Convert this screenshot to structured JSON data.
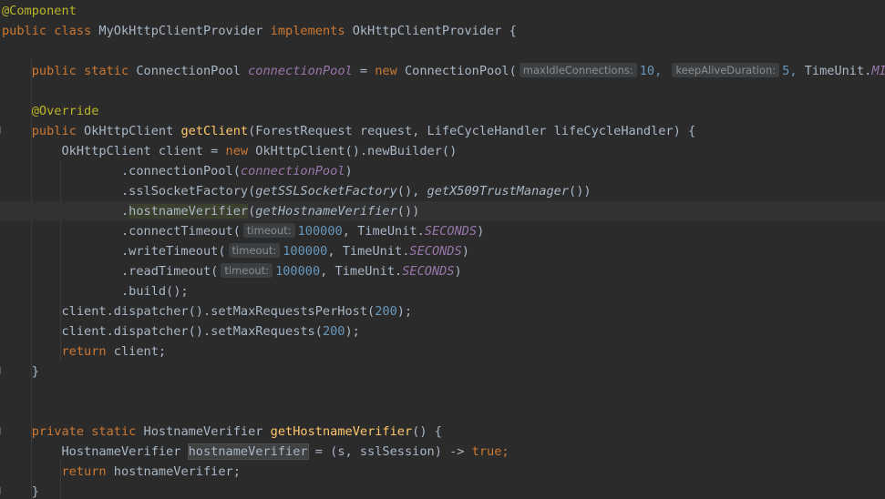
{
  "code": {
    "annotation_component": "@Component",
    "kw_public": "public",
    "kw_class": "class",
    "class_name": "MyOkHttpClientProvider",
    "kw_implements": "implements",
    "iface_name": "OkHttpClientProvider",
    "brace_open": "{",
    "brace_close": "}",
    "kw_static": "static",
    "type_pool": "ConnectionPool",
    "field_pool": "connectionPool",
    "assign": "=",
    "kw_new": "new",
    "ctor_pool": "ConnectionPool(",
    "hint_max_idle": "maxIdleConnections:",
    "num_10": "10,",
    "hint_keep_alive": "keepAliveDuration:",
    "num_5": "5,",
    "time_unit_prefix": "TimeUnit.",
    "time_unit_minutes_partial": "MINU",
    "annotation_override": "@Override",
    "type_client": "OkHttpClient",
    "fn_get_client": "getClient",
    "params_get_client": "(ForestRequest request, LifeCycleHandler lifeCycleHandler)",
    "decl_client": "OkHttpClient client",
    "ctor_client": "OkHttpClient().newBuilder()",
    "call_connection_pool_open": ".connectionPool(",
    "close_paren": ")",
    "call_ssl_open": ".sslSocketFactory(",
    "fn_get_ssl": "getSSLSocketFactory",
    "call_empty": "()",
    "comma_space": ", ",
    "fn_get_trust": "getX509TrustManager",
    "call_close": "())",
    "call_hostname_dot": ".",
    "call_hostname_name": "hostnameVerifier",
    "open_paren": "(",
    "fn_get_hostname": "getHostnameVerifier",
    "call_connect_timeout": ".connectTimeout(",
    "hint_timeout": "timeout:",
    "num_100000": "100000",
    "time_unit_seconds": "SECONDS",
    "call_write_timeout": ".writeTimeout(",
    "call_read_timeout": ".readTimeout(",
    "call_build": ".build();",
    "stmt_dispatcher_host": "client.dispatcher().setMaxRequestsPerHost(",
    "num_200": "200",
    "stmt_end": ");",
    "stmt_dispatcher_max": "client.dispatcher().setMaxRequests(",
    "kw_return": "return",
    "ret_client": "client;",
    "kw_private": "private",
    "type_hostname": "HostnameVerifier",
    "fn_get_hostname_decl": "getHostnameVerifier",
    "empty_parens_brace": "() {",
    "var_hostname": "hostnameVerifier",
    "lambda_params": "(s, sslSession) ->",
    "kw_true": "true",
    "semicolon": ";",
    "ret_hostname": "hostnameVerifier;"
  }
}
